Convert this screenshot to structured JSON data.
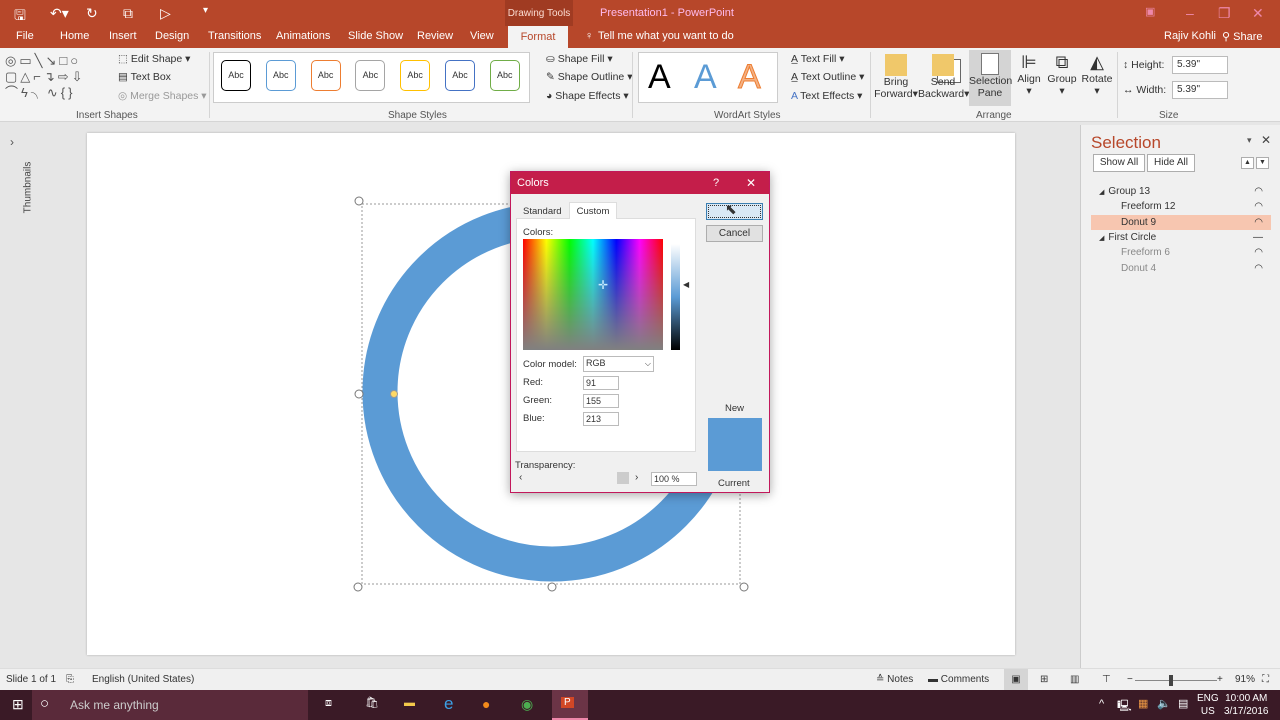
{
  "title_bar": {
    "contextual": "Drawing Tools",
    "title": "Presentation1 - PowerPoint"
  },
  "tabs": [
    "File",
    "Home",
    "Insert",
    "Design",
    "Transitions",
    "Animations",
    "Slide Show",
    "Review",
    "View",
    "Format"
  ],
  "tell_me": "Tell me what you want to do",
  "user": "Rajiv Kohli",
  "share": "Share",
  "ribbon": {
    "insert_shapes": {
      "edit_shape": "Edit Shape",
      "text_box": "Text Box",
      "merge_shapes": "Merge Shapes",
      "label": "Insert Shapes"
    },
    "shape_styles": {
      "swatch": "Abc",
      "colors": [
        "#000000",
        "#5b9bd5",
        "#ed7d31",
        "#a5a5a5",
        "#ffc000",
        "#4472c4",
        "#70ad47"
      ],
      "shape_fill": "Shape Fill",
      "shape_outline": "Shape Outline",
      "shape_effects": "Shape Effects",
      "label": "Shape Styles"
    },
    "wordart": {
      "letter": "A",
      "text_fill": "Text Fill",
      "text_outline": "Text Outline",
      "text_effects": "Text Effects",
      "label": "WordArt Styles"
    },
    "arrange": {
      "bring": "Bring",
      "forward": "Forward",
      "send": "Send",
      "backward": "Backward",
      "selection": "Selection",
      "pane": "Pane",
      "align": "Align",
      "group": "Group",
      "rotate": "Rotate",
      "label": "Arrange"
    },
    "size": {
      "height_label": "Height:",
      "height": "5.39\"",
      "width_label": "Width:",
      "width": "5.39\"",
      "label": "Size"
    }
  },
  "thumbnails": "Thumbnails",
  "shape_color": "#5b9bd5",
  "dialog": {
    "title": "Colors",
    "help": "?",
    "tab_standard": "Standard",
    "tab_custom": "Custom",
    "ok": "",
    "cancel": "Cancel",
    "colors_label": "Colors:",
    "color_model_label": "Color model:",
    "color_model": "RGB",
    "red_label": "Red:",
    "red": "91",
    "green_label": "Green:",
    "green": "155",
    "blue_label": "Blue:",
    "blue": "213",
    "transparency_label": "Transparency:",
    "transparency": "100 %",
    "new": "New",
    "current": "Current",
    "new_color": "#5b9bd5"
  },
  "selection_pane": {
    "title": "Selection",
    "show_all": "Show All",
    "hide_all": "Hide All",
    "items": [
      {
        "label": "Group 13",
        "level": 0,
        "vis": "eye"
      },
      {
        "label": "Freeform 12",
        "level": 1,
        "vis": "eye"
      },
      {
        "label": "Donut 9",
        "level": 1,
        "vis": "eye",
        "selected": true
      },
      {
        "label": "First Circle",
        "level": 0,
        "vis": "hidden"
      },
      {
        "label": "Freeform 6",
        "level": 1,
        "vis": "eye",
        "dim": true
      },
      {
        "label": "Donut 4",
        "level": 1,
        "vis": "eye",
        "dim": true
      }
    ]
  },
  "status": {
    "slide": "Slide 1 of 1",
    "language": "English (United States)",
    "notes": "Notes",
    "comments": "Comments",
    "zoom": "91%"
  },
  "taskbar": {
    "search": "Ask me anything",
    "lang1": "ENG",
    "lang2": "US",
    "time": "10:00 AM",
    "date": "3/17/2016"
  }
}
